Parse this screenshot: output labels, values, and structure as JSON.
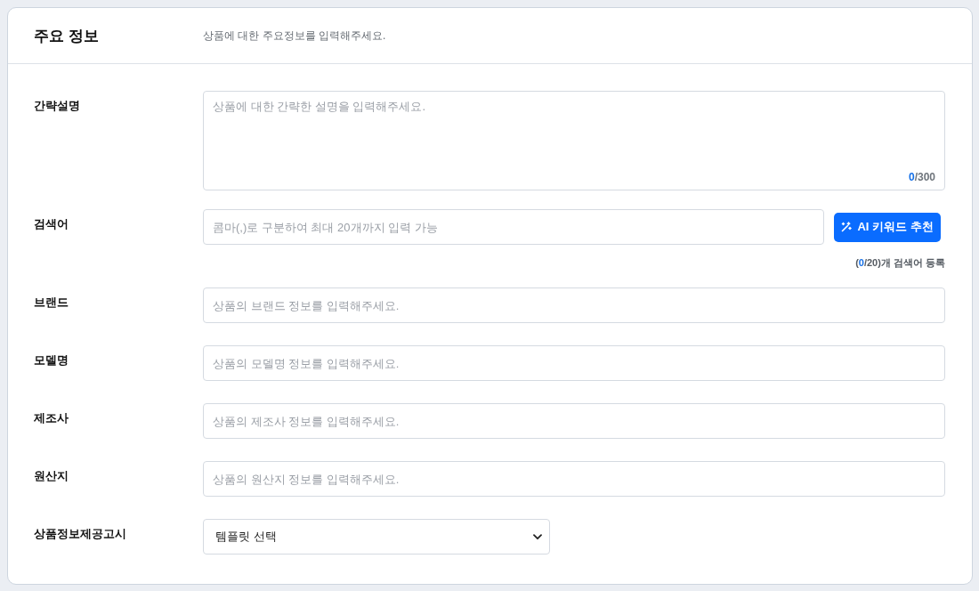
{
  "section": {
    "title": "주요 정보",
    "description": "상품에 대한 주요정보를 입력해주세요."
  },
  "fields": [
    {
      "kind": "textarea",
      "label": "간략설명",
      "placeholder": "상품에 대한 간략한 설명을 입력해주세요.",
      "counter": {
        "count": "0",
        "rest": "/300"
      }
    },
    {
      "kind": "keywords",
      "label": "검색어",
      "placeholder": "콤마(,)로 구분하여 최대 20개까지 입력 가능",
      "button": "AI 키워드 추천",
      "counter": {
        "open": "(",
        "count": "0",
        "rest": "/20)개 검색어 등록"
      }
    },
    {
      "kind": "text",
      "label": "브랜드",
      "placeholder": "상품의 브랜드 정보를 입력해주세요."
    },
    {
      "kind": "text",
      "label": "모델명",
      "placeholder": "상품의 모델명 정보를 입력해주세요."
    },
    {
      "kind": "text",
      "label": "제조사",
      "placeholder": "상품의 제조사 정보를 입력해주세요."
    },
    {
      "kind": "text",
      "label": "원산지",
      "placeholder": "상품의 원산지 정보를 입력해주세요."
    },
    {
      "kind": "select",
      "label": "상품정보제공고시",
      "value": "템플릿 선택"
    }
  ]
}
